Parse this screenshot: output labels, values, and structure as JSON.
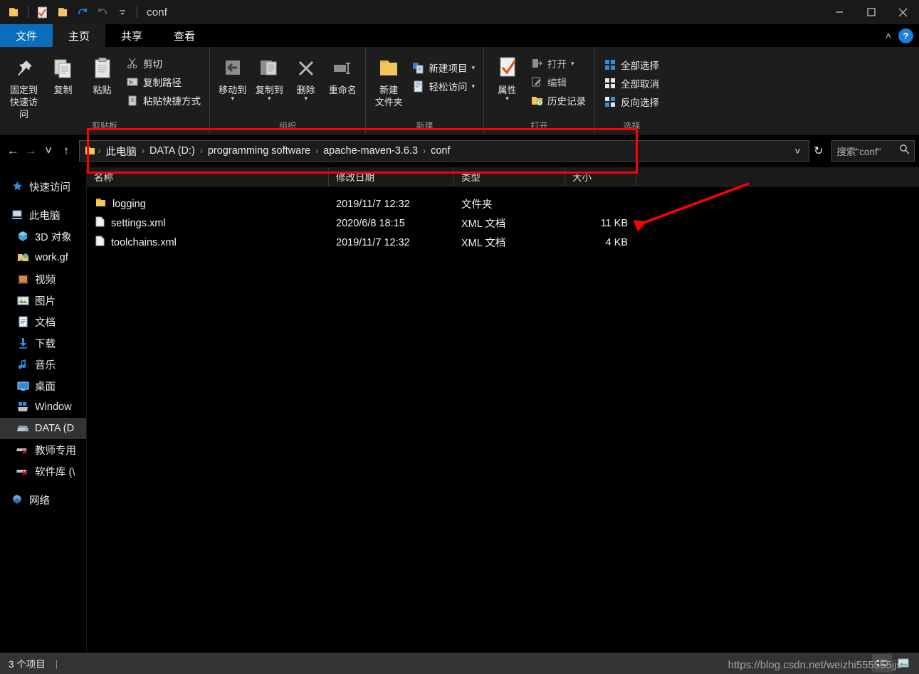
{
  "window": {
    "title": "conf",
    "quick_access_icons": [
      "folder-icon",
      "properties-icon",
      "new-folder-icon",
      "undo-icon",
      "redo-icon",
      "customize-qat-icon"
    ],
    "controls": {
      "minimize": "—",
      "maximize": "☐",
      "close": "✕"
    }
  },
  "ribbon": {
    "tabs": [
      {
        "label": "文件",
        "name": "file"
      },
      {
        "label": "主页",
        "name": "home"
      },
      {
        "label": "共享",
        "name": "share"
      },
      {
        "label": "查看",
        "name": "view"
      }
    ],
    "collapse_icon": "˄",
    "help_label": "?",
    "groups": [
      {
        "label": "剪贴板",
        "big": [
          {
            "label": "固定到\n快速访问",
            "line1": "固定到",
            "line2": "快速访问",
            "icon": "pin-icon"
          },
          {
            "label": "复制",
            "line1": "复制",
            "line2": "",
            "icon": "copy-icon"
          },
          {
            "label": "粘贴",
            "line1": "粘贴",
            "line2": "",
            "icon": "paste-icon"
          }
        ],
        "small": [
          {
            "label": "剪切",
            "icon": "scissors-icon"
          },
          {
            "label": "复制路径",
            "icon": "copy-path-icon"
          },
          {
            "label": "粘贴快捷方式",
            "icon": "paste-shortcut-icon"
          }
        ]
      },
      {
        "label": "组织",
        "big": [
          {
            "line1": "移动到",
            "line2": "",
            "icon": "move-to-icon",
            "caret": true
          },
          {
            "line1": "复制到",
            "line2": "",
            "icon": "copy-to-icon",
            "caret": true
          },
          {
            "line1": "删除",
            "line2": "",
            "icon": "delete-icon",
            "caret": true
          },
          {
            "line1": "重命名",
            "line2": "",
            "icon": "rename-icon",
            "caret": false
          }
        ],
        "small": []
      },
      {
        "label": "新建",
        "big": [
          {
            "line1": "新建",
            "line2": "文件夹",
            "icon": "new-folder-icon",
            "caret": false
          }
        ],
        "small": [
          {
            "label": "新建项目",
            "icon": "new-item-icon",
            "caret": true
          },
          {
            "label": "轻松访问",
            "icon": "easy-access-icon",
            "caret": true
          }
        ]
      },
      {
        "label": "打开",
        "big": [
          {
            "line1": "属性",
            "line2": "",
            "icon": "properties-icon",
            "caret": true
          }
        ],
        "small": [
          {
            "label": "打开",
            "icon": "open-icon",
            "caret": true
          },
          {
            "label": "编辑",
            "icon": "edit-icon",
            "caret": false
          },
          {
            "label": "历史记录",
            "icon": "history-icon",
            "caret": false
          }
        ]
      },
      {
        "label": "选择",
        "big": [],
        "small": [
          {
            "label": "全部选择",
            "icon": "select-all-icon"
          },
          {
            "label": "全部取消",
            "icon": "select-none-icon"
          },
          {
            "label": "反向选择",
            "icon": "invert-selection-icon"
          }
        ]
      }
    ]
  },
  "address": {
    "back_icon": "←",
    "forward_icon": "→",
    "recent_icon": "˅",
    "up_icon": "↑",
    "breadcrumb": [
      "此电脑",
      "DATA (D:)",
      "programming software",
      "apache-maven-3.6.3",
      "conf"
    ],
    "separator": "›",
    "dropdown_icon": "˅",
    "refresh_icon": "↻",
    "search_placeholder": "搜索\"conf\"",
    "search_icon": "search-icon"
  },
  "sidebar": {
    "items": [
      {
        "label": "快速访问",
        "icon": "star-icon",
        "level": 0,
        "selected": false
      },
      {
        "label": "此电脑",
        "icon": "this-pc-icon",
        "level": 0,
        "selected": false
      },
      {
        "label": "3D 对象",
        "icon": "3d-objects-icon",
        "level": 1,
        "selected": false
      },
      {
        "label": "work.gf",
        "icon": "folder-sync-icon",
        "level": 1,
        "selected": false
      },
      {
        "label": "视频",
        "icon": "videos-icon",
        "level": 1,
        "selected": false
      },
      {
        "label": "图片",
        "icon": "pictures-icon",
        "level": 1,
        "selected": false
      },
      {
        "label": "文档",
        "icon": "documents-icon",
        "level": 1,
        "selected": false
      },
      {
        "label": "下载",
        "icon": "downloads-icon",
        "level": 1,
        "selected": false
      },
      {
        "label": "音乐",
        "icon": "music-icon",
        "level": 1,
        "selected": false
      },
      {
        "label": "桌面",
        "icon": "desktop-icon",
        "level": 1,
        "selected": false
      },
      {
        "label": "Window",
        "icon": "windows-drive-icon",
        "level": 1,
        "selected": false
      },
      {
        "label": "DATA (D",
        "icon": "drive-icon",
        "level": 1,
        "selected": true
      },
      {
        "label": "教师专用",
        "icon": "network-drive-disconnected-icon",
        "level": 1,
        "selected": false
      },
      {
        "label": "软件库 (\\",
        "icon": "network-drive-disconnected-icon",
        "level": 1,
        "selected": false
      },
      {
        "label": "网络",
        "icon": "network-icon",
        "level": 0,
        "selected": false
      }
    ]
  },
  "filelist": {
    "columns": [
      "名称",
      "修改日期",
      "类型",
      "大小"
    ],
    "sort_indicator": "^",
    "rows": [
      {
        "name": "logging",
        "date": "2019/11/7 12:32",
        "type": "文件夹",
        "size": "",
        "icon": "folder-icon"
      },
      {
        "name": "settings.xml",
        "date": "2020/6/8 18:15",
        "type": "XML 文档",
        "size": "11 KB",
        "icon": "file-icon"
      },
      {
        "name": "toolchains.xml",
        "date": "2019/11/7 12:32",
        "type": "XML 文档",
        "size": "4 KB",
        "icon": "file-icon"
      }
    ]
  },
  "statusbar": {
    "items_text": "3 个项目",
    "divider": "|",
    "view_buttons": [
      "details-view-icon",
      "large-icons-view-icon"
    ],
    "watermark": "https://blog.csdn.net/weizhi555555jjs"
  },
  "annotations": {
    "accent_color": "#ff0000",
    "rect_label": "address-bar-highlight",
    "arrow_label": "points-to-settings-size"
  }
}
